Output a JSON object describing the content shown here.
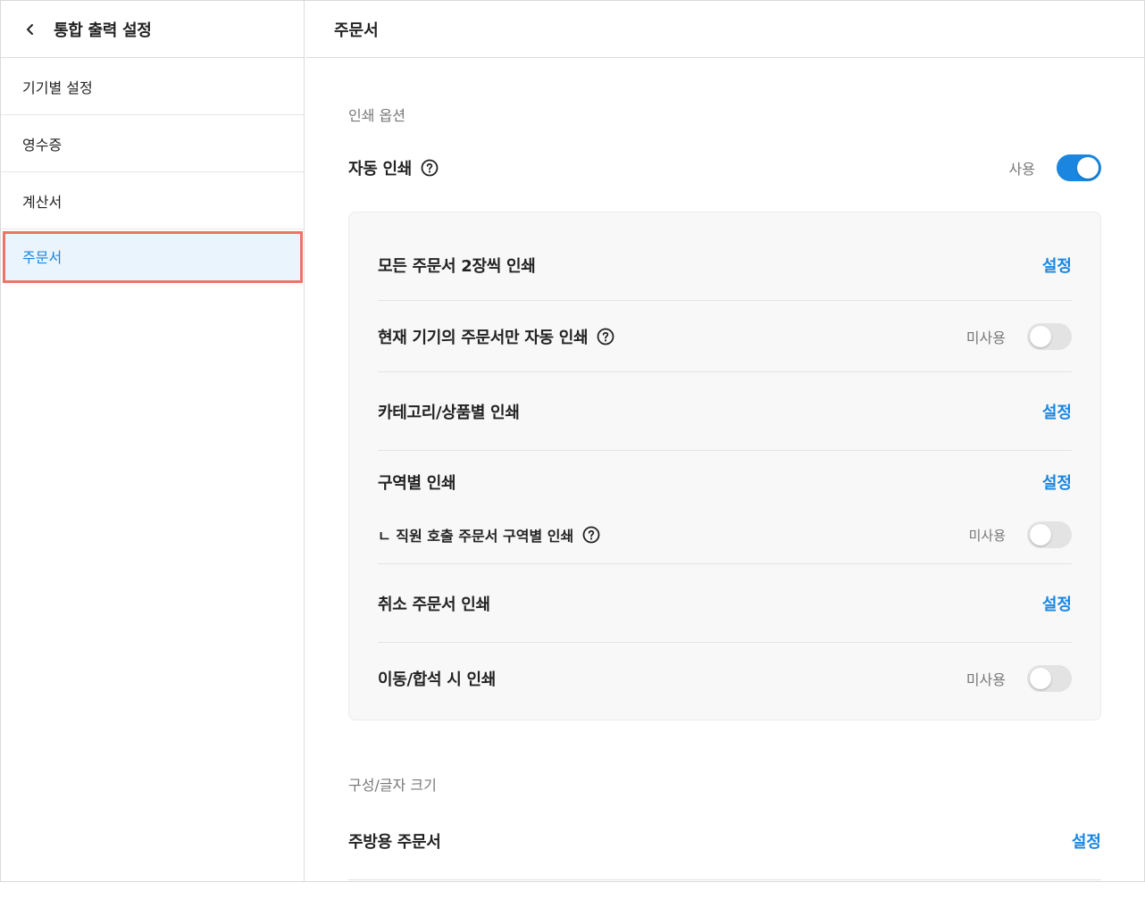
{
  "sidebar": {
    "title": "통합 출력 설정",
    "items": [
      {
        "label": "기기별 설정"
      },
      {
        "label": "영수증"
      },
      {
        "label": "계산서"
      },
      {
        "label": "주문서"
      }
    ]
  },
  "main": {
    "title": "주문서",
    "print_options": {
      "section_label": "인쇄 옵션",
      "auto_print": {
        "label": "자동 인쇄",
        "status": "사용",
        "enabled": true
      },
      "rows": [
        {
          "label": "모든 주문서 2장씩 인쇄",
          "action": "설정"
        },
        {
          "label": "현재 기기의 주문서만 자동 인쇄",
          "status": "미사용",
          "enabled": false
        },
        {
          "label": "카테고리/상품별 인쇄",
          "action": "설정"
        },
        {
          "label": "구역별 인쇄",
          "action": "설정"
        },
        {
          "label": "ㄴ 직원 호출 주문서 구역별 인쇄",
          "status": "미사용",
          "enabled": false
        },
        {
          "label": "취소 주문서 인쇄",
          "action": "설정"
        },
        {
          "label": "이동/합석 시 인쇄",
          "status": "미사용",
          "enabled": false
        }
      ]
    },
    "layout_section": {
      "section_label": "구성/글자 크기",
      "kitchen_order": {
        "label": "주방용 주문서",
        "action": "설정"
      }
    }
  },
  "colors": {
    "accent": "#1a86e0",
    "highlight_border": "#ea7667",
    "active_bg": "#eaf4fd"
  }
}
